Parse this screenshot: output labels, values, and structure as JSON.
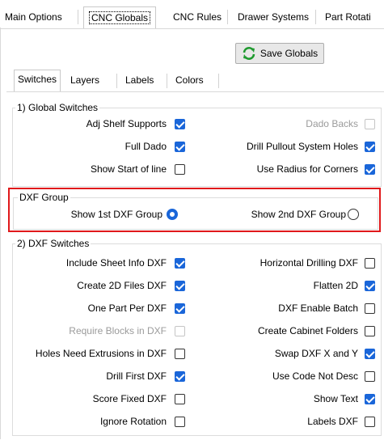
{
  "top_tabs": [
    {
      "label": "Main Options",
      "selected": false
    },
    {
      "label": "CNC Globals",
      "selected": true
    },
    {
      "label": "CNC Rules",
      "selected": false
    },
    {
      "label": "Drawer Systems",
      "selected": false
    },
    {
      "label": "Part Rotati",
      "selected": false
    }
  ],
  "save_button": {
    "label": "Save Globals",
    "icon": "refresh-icon"
  },
  "inner_tabs": [
    {
      "label": "Switches",
      "selected": true
    },
    {
      "label": "Layers",
      "selected": false
    },
    {
      "label": "Labels",
      "selected": false
    },
    {
      "label": "Colors",
      "selected": false
    }
  ],
  "global_switches": {
    "title": "1) Global Switches",
    "left": [
      {
        "label": "Adj Shelf Supports",
        "checked": true,
        "disabled": false
      },
      {
        "label": "Full Dado",
        "checked": true,
        "disabled": false
      },
      {
        "label": "Show Start of line",
        "checked": false,
        "disabled": false
      }
    ],
    "right": [
      {
        "label": "Dado Backs",
        "checked": false,
        "disabled": true
      },
      {
        "label": "Drill Pullout System Holes",
        "checked": true,
        "disabled": false
      },
      {
        "label": "Use Radius for Corners",
        "checked": true,
        "disabled": false
      }
    ]
  },
  "dxf_group": {
    "title": "DXF Group",
    "options": [
      {
        "label": "Show 1st DXF Group",
        "selected": true
      },
      {
        "label": "Show 2nd DXF Group",
        "selected": false
      }
    ]
  },
  "dxf_switches": {
    "title": "2) DXF Switches",
    "left": [
      {
        "label": "Include Sheet Info DXF",
        "checked": true,
        "disabled": false
      },
      {
        "label": "Create 2D Files DXF",
        "checked": true,
        "disabled": false
      },
      {
        "label": "One Part Per DXF",
        "checked": true,
        "disabled": false
      },
      {
        "label": "Require Blocks in DXF",
        "checked": false,
        "disabled": true
      },
      {
        "label": "Holes Need Extrusions in DXF",
        "checked": false,
        "disabled": false
      },
      {
        "label": "Drill First DXF",
        "checked": true,
        "disabled": false
      },
      {
        "label": "Score Fixed DXF",
        "checked": false,
        "disabled": false
      },
      {
        "label": "Ignore Rotation",
        "checked": false,
        "disabled": false
      }
    ],
    "right": [
      {
        "label": "Horizontal Drilling DXF",
        "checked": false,
        "disabled": false
      },
      {
        "label": "Flatten 2D",
        "checked": true,
        "disabled": false
      },
      {
        "label": "DXF Enable Batch",
        "checked": false,
        "disabled": false
      },
      {
        "label": "Create Cabinet Folders",
        "checked": false,
        "disabled": false
      },
      {
        "label": "Swap DXF X and Y",
        "checked": true,
        "disabled": false
      },
      {
        "label": "Use Code Not Desc",
        "checked": false,
        "disabled": false
      },
      {
        "label": "Show Text",
        "checked": true,
        "disabled": false
      },
      {
        "label": "Labels DXF",
        "checked": false,
        "disabled": false
      }
    ]
  },
  "colors": {
    "accent": "#1a66d9",
    "highlight_border": "#e0191b",
    "disabled_text": "#9b9b9b"
  }
}
